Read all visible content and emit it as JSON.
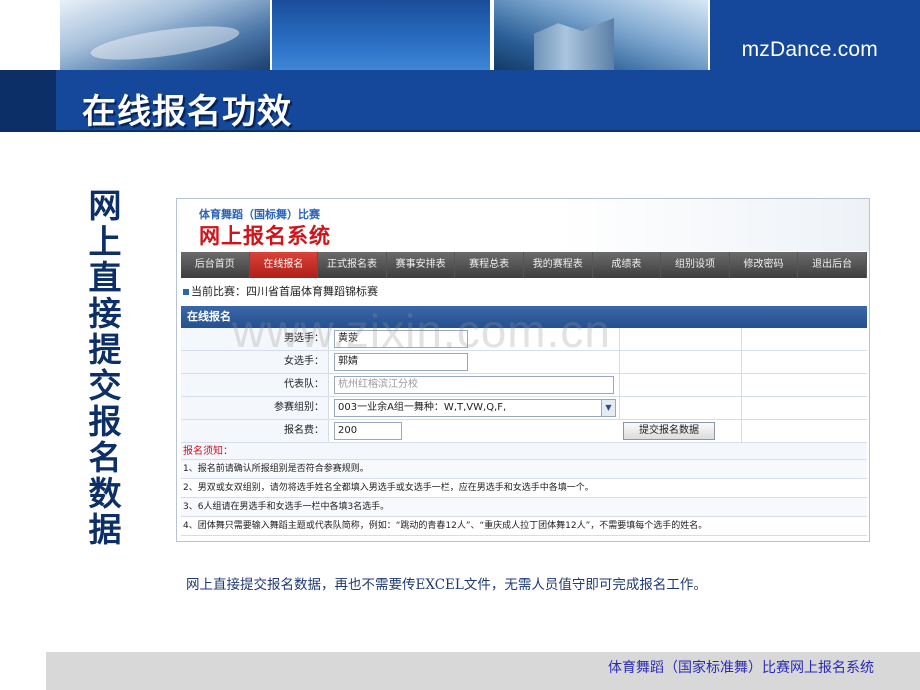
{
  "header": {
    "brand": "mzDance.com",
    "title": "在线报名功效"
  },
  "side_caption": "网上直接提交报名数据",
  "system": {
    "subtitle": "体育舞蹈（国标舞）比赛",
    "title": "网上报名系统",
    "nav": [
      "后台首页",
      "在线报名",
      "正式报名表",
      "赛事安排表",
      "赛程总表",
      "我的赛程表",
      "成绩表",
      "组别设项",
      "修改密码",
      "退出后台"
    ],
    "active_nav": "在线报名",
    "current_label": "当前比赛：四川省首届体育舞蹈锦标赛",
    "panel_title": "在线报名",
    "form": {
      "male_label": "男选手：",
      "male_value": "黄荥",
      "female_label": "女选手：",
      "female_value": "郭婧",
      "team_label": "代表队：",
      "team_value": "杭州红榕滨江分校",
      "group_label": "参赛组别：",
      "group_value": "003一业余A组一舞种：W,T,VW,Q,F,",
      "fee_label": "报名费：",
      "fee_value": "200",
      "submit_label": "提交报名数据"
    },
    "notice_title": "报名须知：",
    "notices": [
      "1、报名前请确认所报组别是否符合参赛规则。",
      "2、男双或女双组别，请勿将选手姓名全都填入男选手或女选手一栏，应在男选手和女选手中各填一个。",
      "3、6人组请在男选手和女选手一栏中各填3名选手。",
      "4、团体舞只需要输入舞蹈主题或代表队简称，例如：“跳动的青春12人”、“重庆成人拉丁团体舞12人”，不需要填每个选手的姓名。"
    ]
  },
  "watermark": "www.zixin.com.cn",
  "caption": "网上直接提交报名数据，再也不需要传EXCEL文件，无需人员值守即可完成报名工作。",
  "footer": "体育舞蹈（国家标准舞）比赛网上报名系统",
  "colors": {
    "brand_blue": "#15479a",
    "dark_blue": "#0d2f68",
    "accent_red": "#d0141a",
    "footer_text": "#2a2ab8"
  }
}
